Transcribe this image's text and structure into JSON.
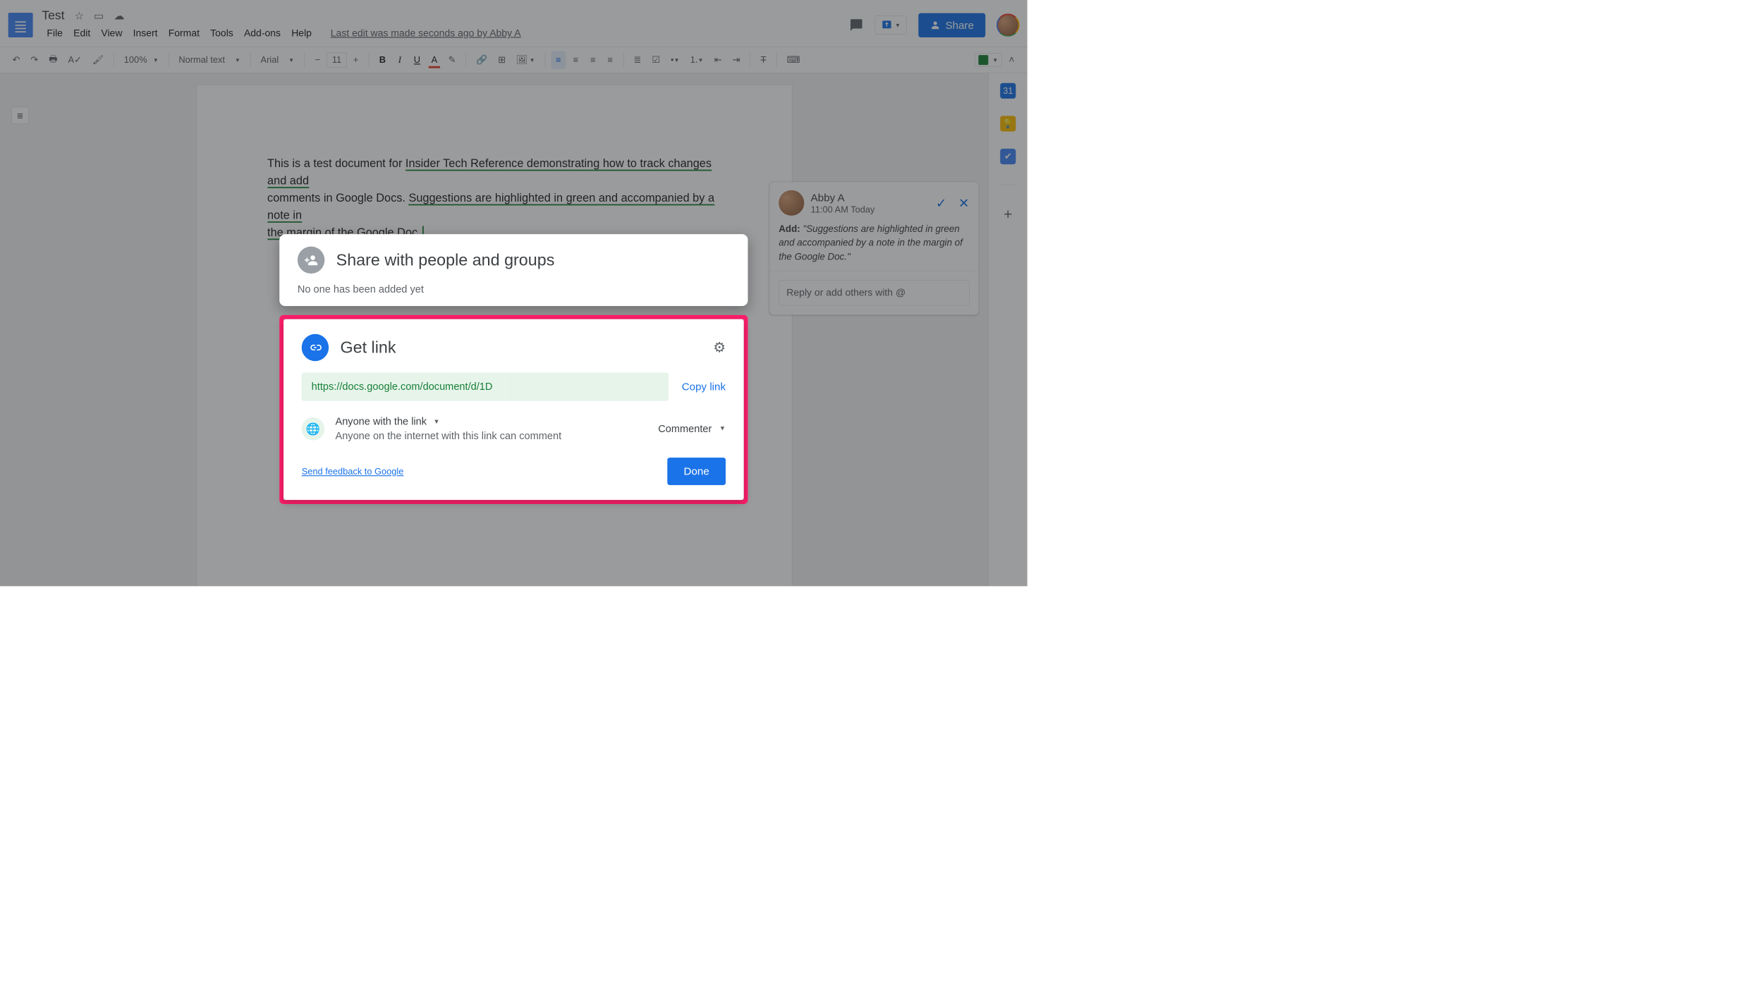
{
  "header": {
    "doc_title": "Test",
    "menu": {
      "file": "File",
      "edit": "Edit",
      "view": "View",
      "insert": "Insert",
      "format": "Format",
      "tools": "Tools",
      "addons": "Add-ons",
      "help": "Help"
    },
    "last_edit": "Last edit was made seconds ago by Abby A",
    "share_label": "Share"
  },
  "toolbar": {
    "zoom": "100%",
    "style": "Normal text",
    "font": "Arial",
    "font_size": "11"
  },
  "document": {
    "text_plain": "This is a test document for ",
    "text_sugg_link": "Insider Tech Reference demonstrating how to track changes and add",
    "text_line2_plain": "comments in Google Docs. ",
    "text_line2_sugg": "Suggestions are highlighted in green and accompanied by a note in",
    "text_line3_sugg": "the margin of the Google Doc."
  },
  "suggestion": {
    "author": "Abby A",
    "time": "11:00 AM Today",
    "action_label": "Add:",
    "text": "\"Suggestions are highlighted in green and accompanied by a note in the margin of the Google Doc.\"",
    "reply_placeholder": "Reply or add others with @"
  },
  "share_dialog": {
    "title": "Share with people and groups",
    "subtitle": "No one has been added yet"
  },
  "getlink_dialog": {
    "title": "Get link",
    "url": "https://docs.google.com/document/d/1D",
    "copy_label": "Copy link",
    "access_title": "Anyone with the link",
    "access_desc": "Anyone on the internet with this link can comment",
    "role": "Commenter",
    "feedback": "Send feedback to Google",
    "done": "Done"
  }
}
